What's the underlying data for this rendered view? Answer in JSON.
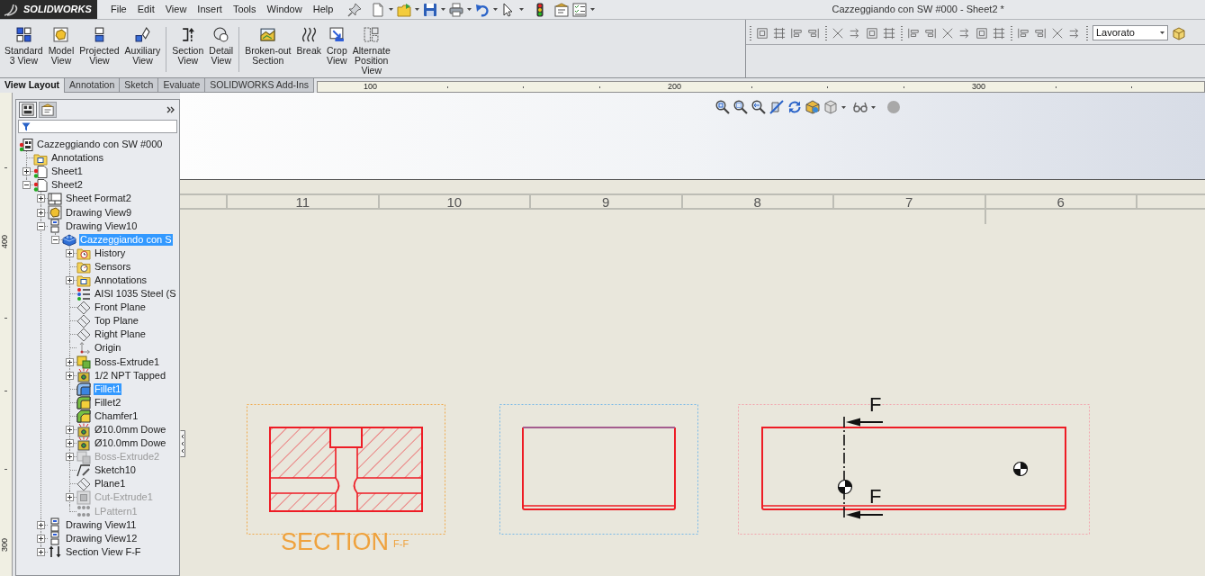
{
  "app": {
    "logo_text": "SOLIDWORKS"
  },
  "menu": [
    "File",
    "Edit",
    "View",
    "Insert",
    "Tools",
    "Window",
    "Help"
  ],
  "window": {
    "title": "Cazzeggiando con SW #000 - Sheet2 *"
  },
  "command_groups": [
    {
      "buttons": [
        {
          "label": "Standard\n3 View",
          "kind": "standard"
        },
        {
          "label": "Model\nView",
          "kind": "model"
        },
        {
          "label": "Projected\nView",
          "kind": "projected"
        },
        {
          "label": "Auxiliary\nView",
          "kind": "auxiliary"
        }
      ]
    },
    {
      "buttons": [
        {
          "label": "Section\nView",
          "kind": "section"
        },
        {
          "label": "Detail\nView",
          "kind": "detail"
        }
      ]
    },
    {
      "buttons": [
        {
          "label": "Broken-out\nSection",
          "kind": "brokenout"
        },
        {
          "label": "Break",
          "kind": "break"
        },
        {
          "label": "Crop\nView",
          "kind": "crop"
        },
        {
          "label": "Alternate\nPosition\nView",
          "kind": "alternate"
        }
      ]
    }
  ],
  "config_select": {
    "value": "Lavorato"
  },
  "tabs": [
    {
      "label": "View Layout",
      "selected": true
    },
    {
      "label": "Annotation",
      "selected": false
    },
    {
      "label": "Sketch",
      "selected": false
    },
    {
      "label": "Evaluate",
      "selected": false
    },
    {
      "label": "SOLIDWORKS Add-Ins",
      "selected": false
    }
  ],
  "ruler_top": {
    "labels": [
      "100",
      "200",
      "300"
    ]
  },
  "ruler_left": {
    "labels": [
      "400",
      "300"
    ]
  },
  "tree_tabs": [
    {
      "selected": true
    },
    {
      "selected": false
    }
  ],
  "feature_tree": {
    "items": [
      {
        "label": "Cazzeggiando con SW #000",
        "kind": "drawing",
        "selected": false,
        "suppressed": false,
        "children": [
          {
            "label": "Annotations",
            "kind": "annotations",
            "selected": false,
            "suppressed": false
          },
          {
            "label": "Sheet1",
            "kind": "sheet",
            "expanded": false,
            "selected": false,
            "suppressed": false
          },
          {
            "label": "Sheet2",
            "kind": "sheet",
            "expanded": true,
            "selected": false,
            "suppressed": false,
            "children": [
              {
                "label": "Sheet Format2",
                "kind": "sheet-format",
                "expanded": false,
                "selected": false,
                "suppressed": false
              },
              {
                "label": "Drawing View9",
                "kind": "model-view",
                "expanded": false,
                "selected": false,
                "suppressed": false
              },
              {
                "label": "Drawing View10",
                "kind": "projected-view",
                "expanded": true,
                "selected": false,
                "suppressed": false,
                "children": [
                  {
                    "label": "Cazzeggiando con S",
                    "kind": "part",
                    "expanded": true,
                    "selected": true,
                    "suppressed": false,
                    "children": [
                      {
                        "label": "History",
                        "kind": "history",
                        "expanded": false,
                        "selected": false,
                        "suppressed": false
                      },
                      {
                        "label": "Sensors",
                        "kind": "sensors",
                        "selected": false,
                        "suppressed": false
                      },
                      {
                        "label": "Annotations",
                        "kind": "annotations",
                        "expanded": false,
                        "selected": false,
                        "suppressed": false
                      },
                      {
                        "label": "AISI 1035 Steel (S",
                        "kind": "material",
                        "selected": false,
                        "suppressed": false
                      },
                      {
                        "label": "Front Plane",
                        "kind": "plane",
                        "selected": false,
                        "suppressed": false
                      },
                      {
                        "label": "Top Plane",
                        "kind": "plane",
                        "selected": false,
                        "suppressed": false
                      },
                      {
                        "label": "Right Plane",
                        "kind": "plane",
                        "selected": false,
                        "suppressed": false
                      },
                      {
                        "label": "Origin",
                        "kind": "origin",
                        "selected": false,
                        "suppressed": false
                      },
                      {
                        "label": "Boss-Extrude1",
                        "kind": "extrude",
                        "expanded": false,
                        "selected": false,
                        "suppressed": false
                      },
                      {
                        "label": "1/2 NPT Tapped",
                        "kind": "hole",
                        "expanded": false,
                        "selected": false,
                        "suppressed": false
                      },
                      {
                        "label": "Fillet1",
                        "kind": "fillet",
                        "selected": true,
                        "suppressed": false
                      },
                      {
                        "label": "Fillet2",
                        "kind": "fillet",
                        "selected": false,
                        "suppressed": false
                      },
                      {
                        "label": "Chamfer1",
                        "kind": "chamfer",
                        "selected": false,
                        "suppressed": false
                      },
                      {
                        "label": "Ø10.0mm Dowe",
                        "kind": "hole",
                        "expanded": false,
                        "selected": false,
                        "suppressed": false
                      },
                      {
                        "label": "Ø10.0mm Dowe",
                        "kind": "hole",
                        "expanded": false,
                        "selected": false,
                        "suppressed": false
                      },
                      {
                        "label": "Boss-Extrude2",
                        "kind": "extrude",
                        "expanded": false,
                        "selected": false,
                        "suppressed": true
                      },
                      {
                        "label": "Sketch10",
                        "kind": "sketch",
                        "selected": false,
                        "suppressed": false
                      },
                      {
                        "label": "Plane1",
                        "kind": "plane",
                        "selected": false,
                        "suppressed": false
                      },
                      {
                        "label": "Cut-Extrude1",
                        "kind": "cut",
                        "expanded": false,
                        "selected": false,
                        "suppressed": true
                      },
                      {
                        "label": "LPattern1",
                        "kind": "pattern",
                        "selected": false,
                        "suppressed": true
                      }
                    ]
                  }
                ]
              },
              {
                "label": "Drawing View11",
                "kind": "projected-view",
                "expanded": false,
                "selected": false,
                "suppressed": false
              },
              {
                "label": "Drawing View12",
                "kind": "projected-view",
                "expanded": false,
                "selected": false,
                "suppressed": false
              },
              {
                "label": "Section View F-F",
                "kind": "section-view",
                "expanded": false,
                "selected": false,
                "suppressed": false
              }
            ]
          }
        ]
      }
    ]
  },
  "sheet": {
    "zones": [
      "11",
      "10",
      "9",
      "8",
      "7",
      "6"
    ],
    "views": [
      {
        "kind": "section",
        "caption": "SECTION",
        "caption_suffix": "F-F"
      },
      {
        "kind": "side"
      },
      {
        "kind": "cut-plan",
        "arrow_labels": [
          "F",
          "F"
        ]
      }
    ]
  }
}
